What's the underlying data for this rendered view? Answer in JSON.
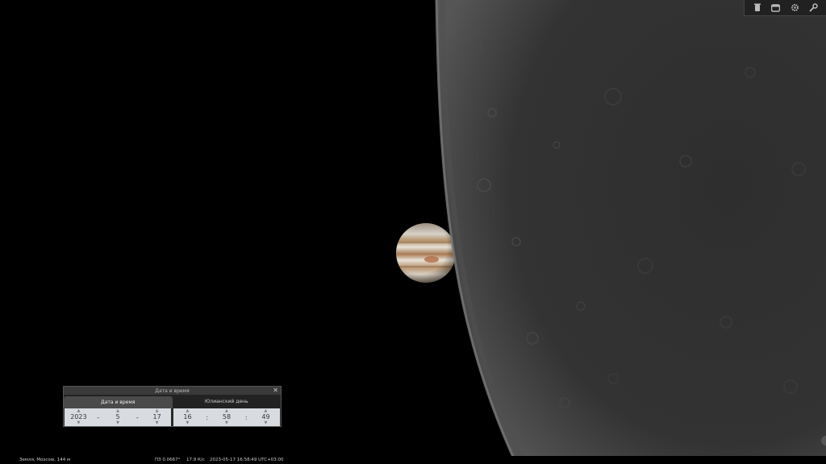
{
  "toolbar": {
    "icons": [
      "trash-icon",
      "window-icon",
      "gear-icon",
      "wrench-icon"
    ]
  },
  "datetime_window": {
    "title": "Дата и время",
    "close_label": "✕",
    "tabs": [
      "Дата и время",
      "Юлианский день"
    ],
    "date": {
      "year": "2023",
      "month": "5",
      "day": "17",
      "separator": "-"
    },
    "time": {
      "hour": "16",
      "minute": "58",
      "second": "49",
      "separator": ":"
    },
    "spin_up": "▲",
    "spin_down": "▼"
  },
  "statusbar": {
    "location": "Земля, Moscow, 144 м",
    "fov": "ПЗ 0.0667°",
    "fps": "17.9 К/с",
    "datetime": "2023-05-17 16:58:49 UTC+03:00"
  },
  "colors": {
    "moon": "#3a3a3a",
    "jupiter": "#c9b8a0",
    "panel": "#2a2a2a"
  }
}
